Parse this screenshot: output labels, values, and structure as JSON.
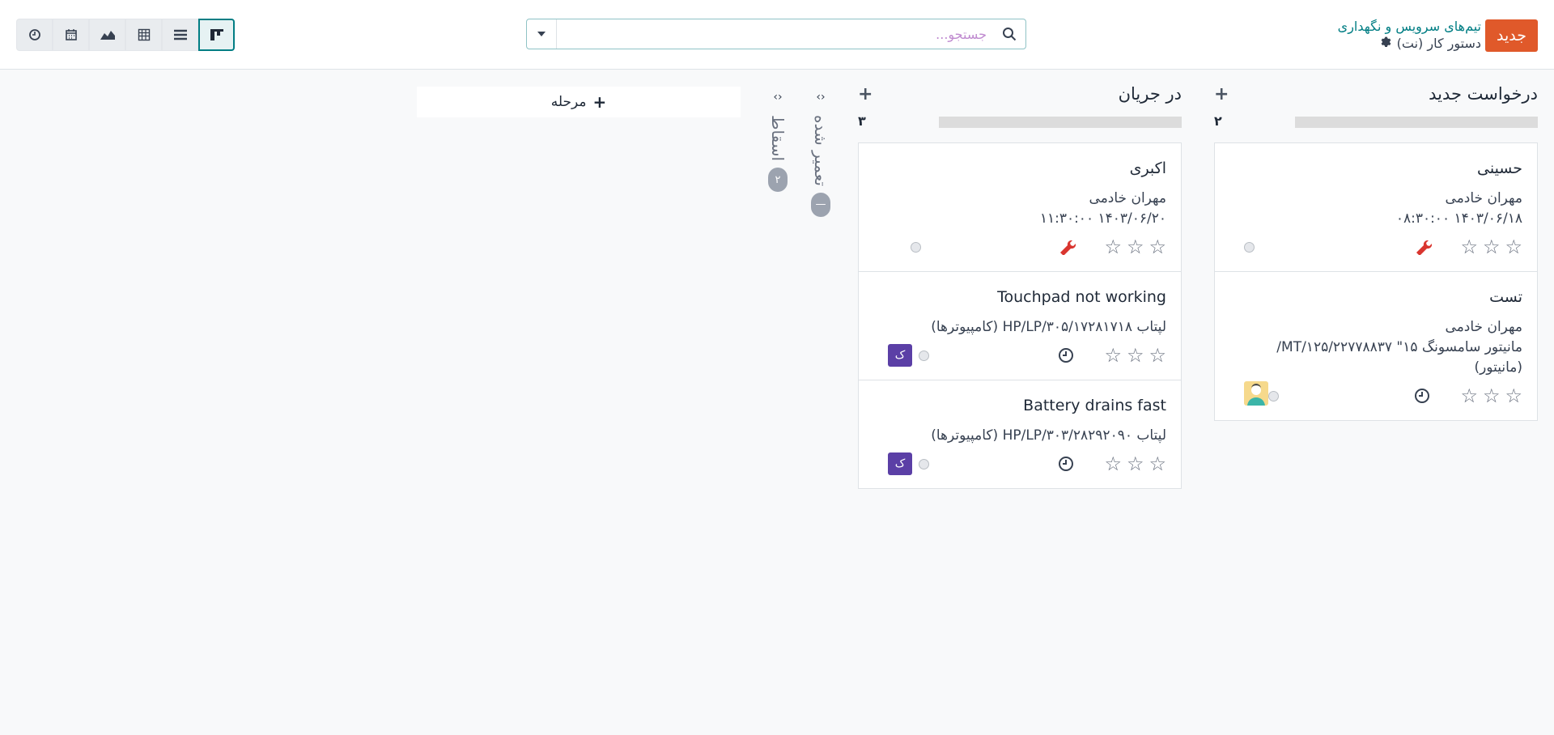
{
  "header": {
    "new_button": "جدید",
    "breadcrumb_parent": "تیم‌های سرویس و نگهداری",
    "breadcrumb_current": "دستور کار (نت)",
    "search_placeholder": "جستجو...",
    "icons": [
      "gear-icon",
      "search-icon",
      "caret-down-icon",
      "kanban-icon",
      "list-icon",
      "pivot-icon",
      "graph-icon",
      "calendar-icon",
      "activity-icon"
    ]
  },
  "columns": [
    {
      "title": "درخواست جدید",
      "count": "۲",
      "cards": [
        {
          "title": "حسینی",
          "lines": [
            "مهران خادمی",
            "۱۴۰۳/۰۶/۱۸ ۰۸:۳۰:۰۰"
          ],
          "activity": "wrench-icon",
          "avatar": ""
        },
        {
          "title": "تست",
          "lines": [
            "مهران خادمی",
            "مانیتور سامسونگ ۱۵\" MT/۱۲۵/۲۲۷۷۸۸۳۷/",
            "(مانیتور)"
          ],
          "activity": "clock-icon",
          "avatar": "image"
        }
      ]
    },
    {
      "title": "در جریان",
      "count": "۳",
      "cards": [
        {
          "title": "اکبری",
          "lines": [
            "مهران خادمی",
            "۱۴۰۳/۰۶/۲۰ ۱۱:۳۰:۰۰"
          ],
          "activity": "wrench-icon",
          "avatar": ""
        },
        {
          "title": "Touchpad not working",
          "lines": [
            "لپتاب HP/LP/۳۰۵/۱۷۲۸۱۷۱۸ (کامپیوترها)"
          ],
          "activity": "clock-icon",
          "avatar": "ک"
        },
        {
          "title": "Battery drains fast",
          "lines": [
            "لپتاب HP/LP/۳۰۳/۲۸۲۹۲۰۹۰ (کامپیوترها)"
          ],
          "activity": "clock-icon",
          "avatar": "ک"
        }
      ]
    }
  ],
  "folded": [
    {
      "title": "تعمیر شده",
      "count": "—"
    },
    {
      "title": "اسقاط",
      "count": "۲"
    }
  ],
  "add_stage_label": "مرحله",
  "colors": {
    "accent": "#017e84",
    "new_button": "#e0592a",
    "avatar": "#5b3fa6",
    "wrench": "#d9352f"
  }
}
